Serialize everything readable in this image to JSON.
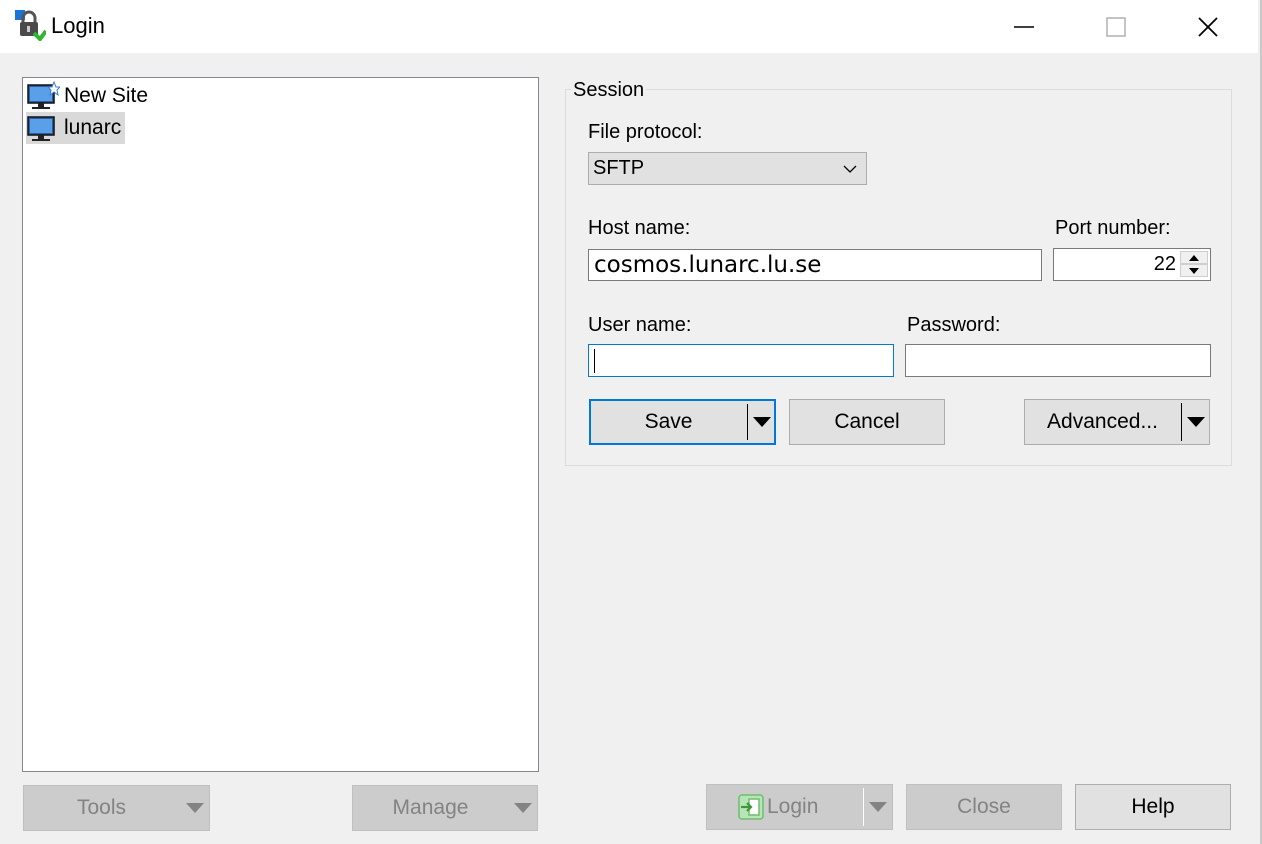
{
  "window": {
    "title": "Login",
    "controls": {
      "minimize": "minimize-icon",
      "maximize": "maximize-icon",
      "close": "close-icon"
    }
  },
  "sites": [
    {
      "label": "New Site",
      "icon": "new-site-icon",
      "selected": false
    },
    {
      "label": "lunarc",
      "icon": "computer-icon",
      "selected": true
    }
  ],
  "session": {
    "group_label": "Session",
    "file_protocol_label": "File protocol:",
    "file_protocol_value": "SFTP",
    "host_name_label": "Host name:",
    "host_name_value": "cosmos.lunarc.lu.se",
    "port_number_label": "Port number:",
    "port_number_value": "22",
    "user_name_label": "User name:",
    "user_name_value": "",
    "password_label": "Password:",
    "password_value": "",
    "save_label": "Save",
    "cancel_label": "Cancel",
    "advanced_label": "Advanced..."
  },
  "footer": {
    "tools_label": "Tools",
    "manage_label": "Manage",
    "login_label": "Login",
    "close_label": "Close",
    "help_label": "Help"
  },
  "colors": {
    "accent": "#0078d7",
    "window_bg": "#f0f0f0",
    "disabled_text": "#838383"
  }
}
